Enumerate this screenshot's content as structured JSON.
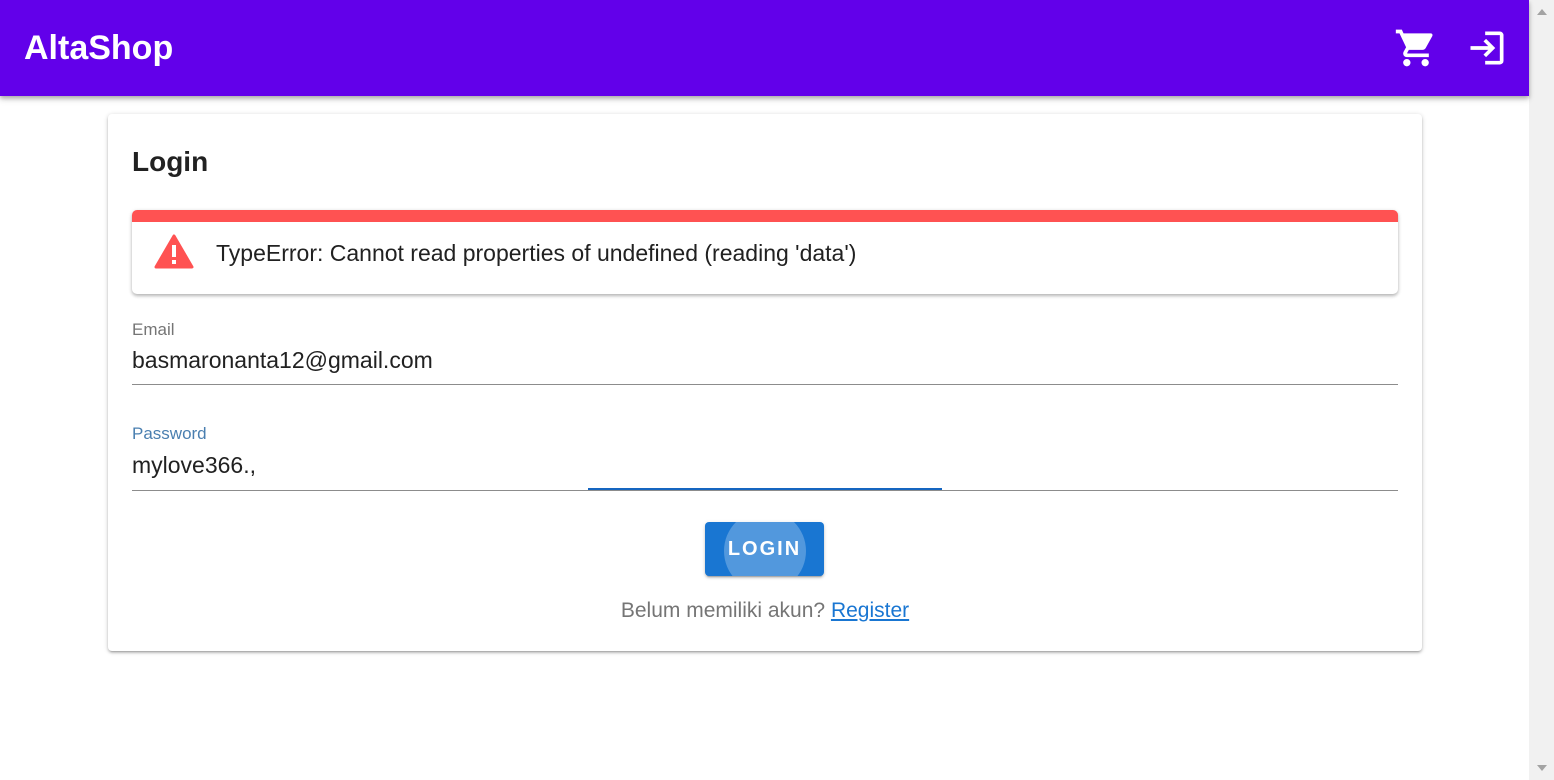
{
  "appbar": {
    "brand": "AltaShop",
    "cart_icon": "cart-icon",
    "login_icon": "login-icon",
    "color": "#6200ea"
  },
  "card": {
    "title": "Login"
  },
  "alert": {
    "type": "error",
    "icon": "warning-icon",
    "message": "TypeError: Cannot read properties of undefined (reading 'data')",
    "color": "#ff5252"
  },
  "form": {
    "email": {
      "label": "Email",
      "value": "basmaronanta12@gmail.com"
    },
    "password": {
      "label": "Password",
      "value": "mylove366.,"
    },
    "login_button": "LOGIN",
    "button_color": "#1976d2"
  },
  "register": {
    "prompt": "Belum memiliki akun?",
    "link": "Register"
  }
}
